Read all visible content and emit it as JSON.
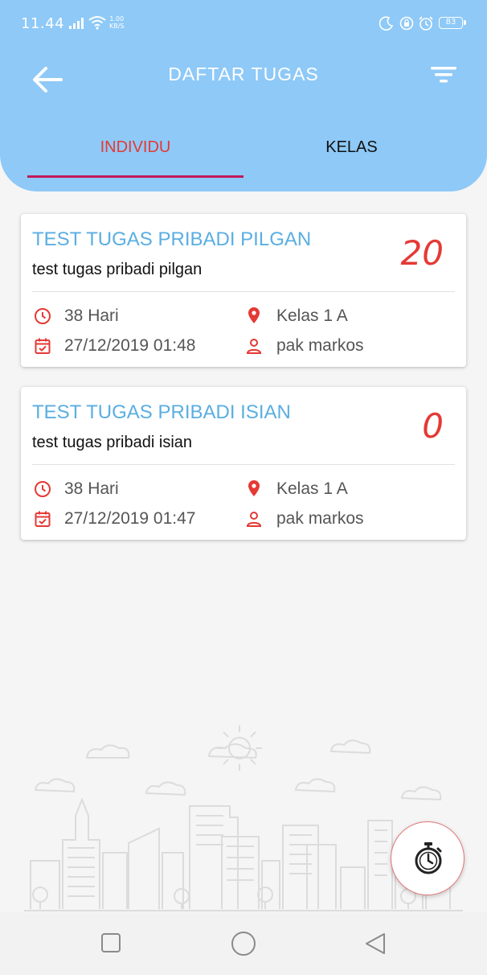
{
  "status_bar": {
    "time": "11.44",
    "net_speed_value": "1.00",
    "net_speed_unit": "KB/S",
    "battery": "83"
  },
  "header": {
    "title": "DAFTAR TUGAS",
    "back_icon": "arrow-left-icon",
    "filter_icon": "filter-icon"
  },
  "tabs": [
    {
      "label": "INDIVIDU",
      "active": true
    },
    {
      "label": "KELAS",
      "active": false
    }
  ],
  "tasks": [
    {
      "title": "TEST TUGAS PRIBADI PILGAN",
      "subtitle": "test tugas pribadi pilgan",
      "score": "20",
      "duration": "38 Hari",
      "datetime": "27/12/2019 01:48",
      "class": "Kelas 1 A",
      "teacher": "pak markos"
    },
    {
      "title": "TEST TUGAS PRIBADI ISIAN",
      "subtitle": "test tugas pribadi isian",
      "score": "0",
      "duration": "38 Hari",
      "datetime": "27/12/2019 01:47",
      "class": "Kelas 1 A",
      "teacher": "pak markos"
    }
  ],
  "fab": {
    "icon": "stopwatch-icon"
  },
  "colors": {
    "header_bg": "#8ec9f7",
    "accent_red": "#e53935",
    "title_blue": "#5aaee2",
    "tab_indicator": "#c2185b"
  }
}
